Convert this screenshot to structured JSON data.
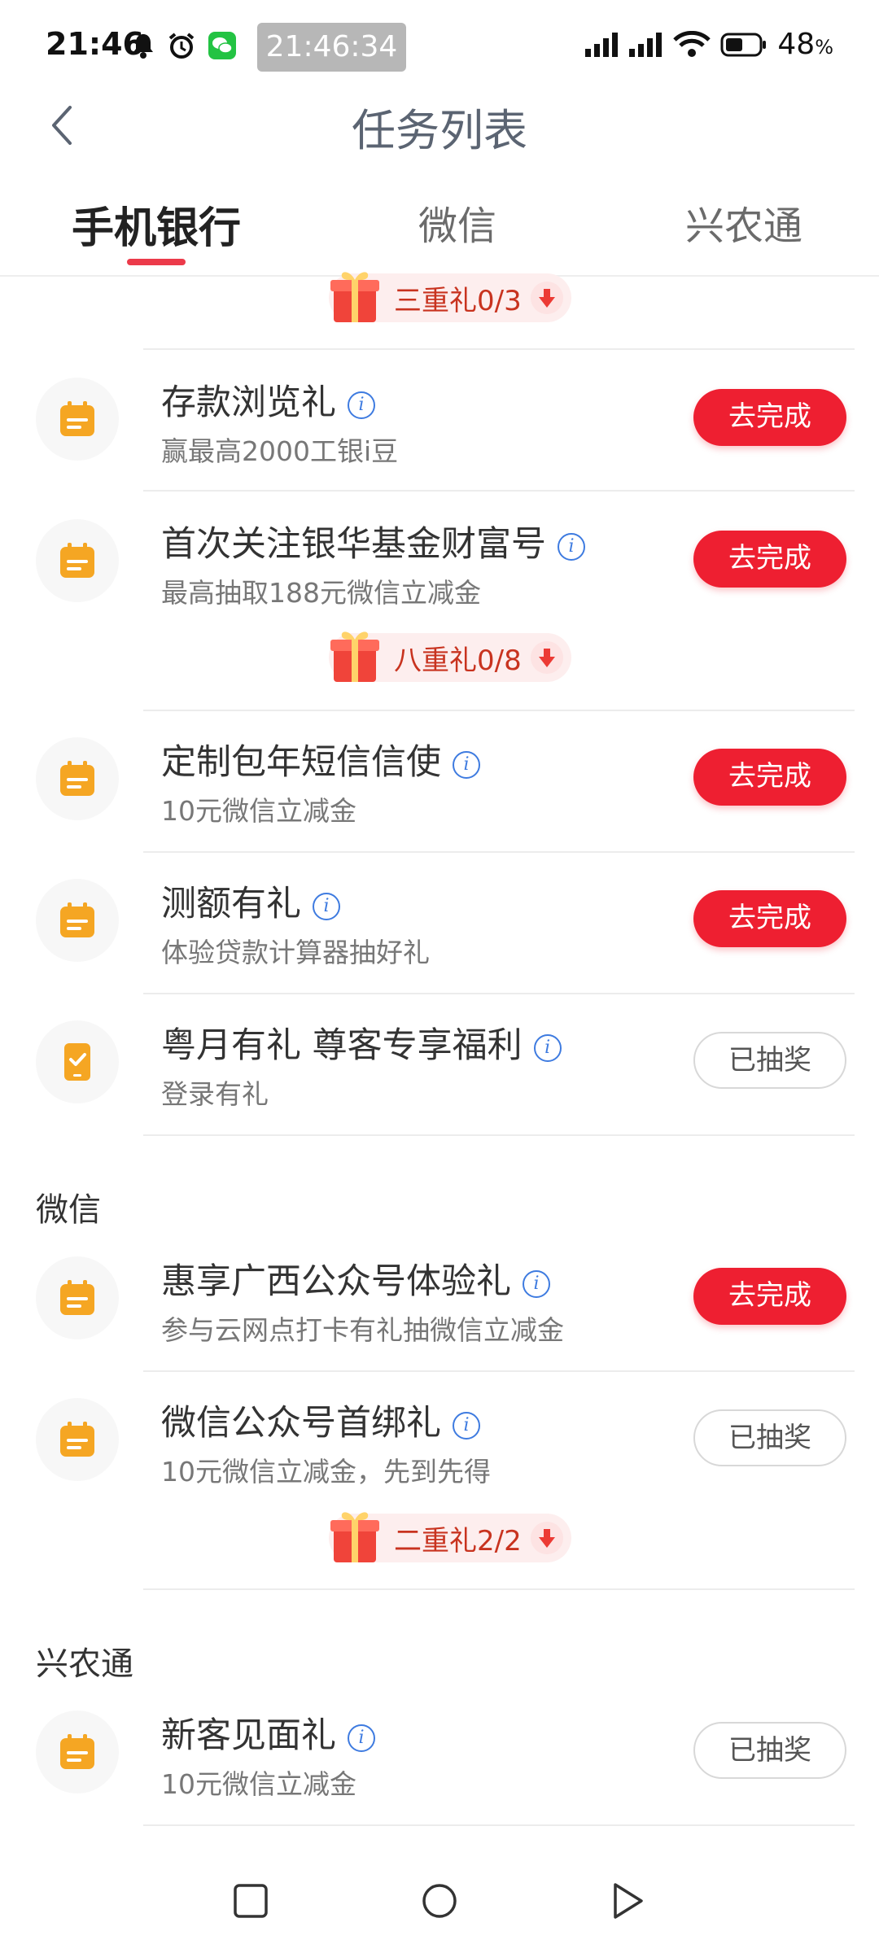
{
  "status": {
    "time": "21:46",
    "chip": "21:46:34",
    "battery": "48",
    "battery_unit": "%"
  },
  "header": {
    "title": "任务列表"
  },
  "tabs": [
    {
      "label": "手机银行",
      "active": true
    },
    {
      "label": "微信",
      "active": false
    },
    {
      "label": "兴农通",
      "active": false
    }
  ],
  "gifts": {
    "g1": "三重礼0/3",
    "g2": "八重礼0/8",
    "g3": "二重礼2/2"
  },
  "sections": {
    "wechat": "微信",
    "xnt": "兴农通"
  },
  "items": [
    {
      "title": "存款浏览礼",
      "sub": "赢最高2000工银i豆",
      "btn": "去完成",
      "icon": "calendar-icon"
    },
    {
      "title": "首次关注银华基金财富号",
      "sub": "最高抽取188元微信立减金",
      "btn": "去完成",
      "icon": "calendar-icon"
    },
    {
      "title": "定制包年短信信使",
      "sub": "10元微信立减金",
      "btn": "去完成",
      "icon": "calendar-icon"
    },
    {
      "title": "测额有礼",
      "sub": "体验贷款计算器抽好礼",
      "btn": "去完成",
      "icon": "calendar-icon"
    },
    {
      "title": "粤月有礼 尊客专享福利",
      "sub": "登录有礼",
      "btn": "已抽奖",
      "icon": "phone-check-icon"
    },
    {
      "title": "惠享广西公众号体验礼",
      "sub": "参与云网点打卡有礼抽微信立减金",
      "btn": "去完成",
      "icon": "calendar-icon"
    },
    {
      "title": "微信公众号首绑礼",
      "sub": "10元微信立减金，先到先得",
      "btn": "已抽奖",
      "icon": "calendar-icon"
    },
    {
      "title": "新客见面礼",
      "sub": "10元微信立减金",
      "btn": "已抽奖",
      "icon": "calendar-icon"
    }
  ],
  "info_glyph": "i",
  "colors": {
    "accent": "#ee1f31",
    "icon": "#f5a623",
    "gift_text": "#c8331f"
  }
}
